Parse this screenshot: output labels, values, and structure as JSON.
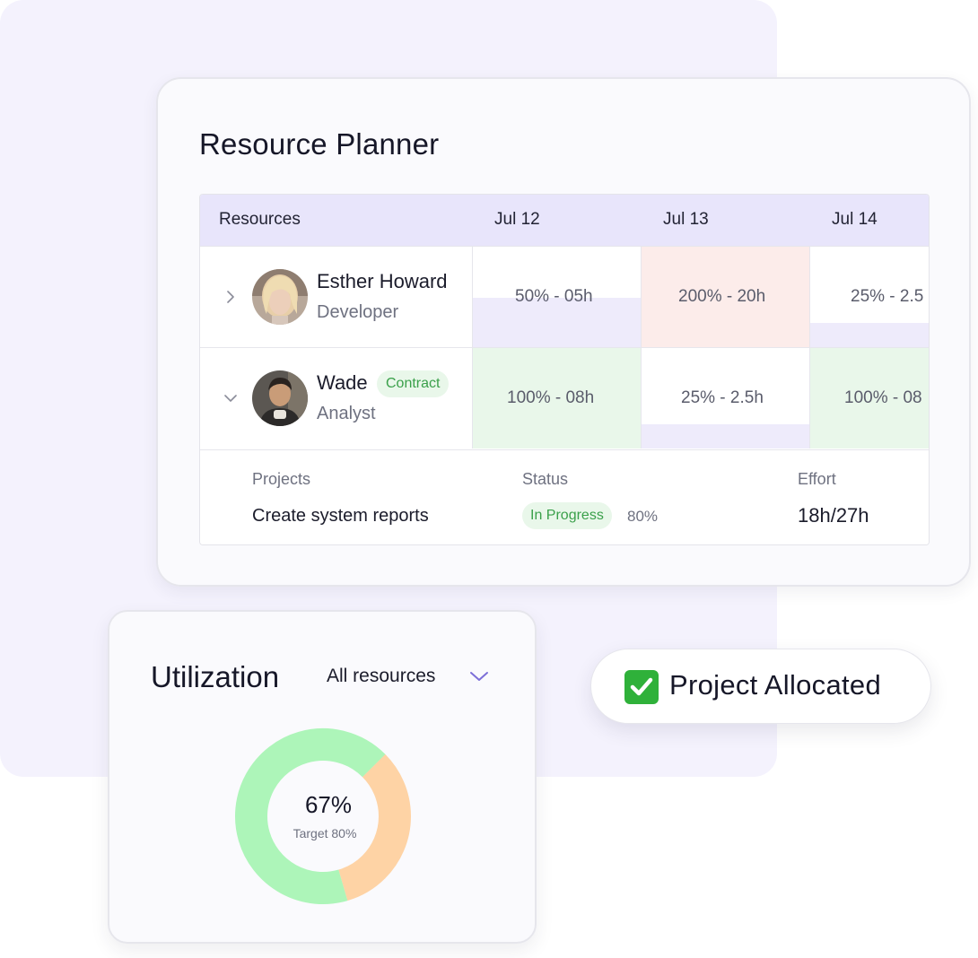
{
  "planner": {
    "title": "Resource Planner",
    "headers": {
      "resources": "Resources",
      "col1": "Jul 12",
      "col2": "Jul 13",
      "col3": "Jul 14"
    },
    "rows": [
      {
        "name": "Esther Howard",
        "role": "Developer",
        "tag": "",
        "expanded": false,
        "chevron_icon": "chevron-right-icon",
        "cells": [
          {
            "text": "50% - 05h",
            "allocation": 0.5,
            "fill_color": "#eeebfb",
            "bg_color": "#ffffff"
          },
          {
            "text": "200% - 20h",
            "allocation": 2.0,
            "fill_color": "#fcecea",
            "bg_color": "#fcecea"
          },
          {
            "text": "25% - 2.5",
            "allocation": 0.25,
            "fill_color": "#eeebfb",
            "bg_color": "#ffffff"
          }
        ]
      },
      {
        "name": "Wade",
        "role": "Analyst",
        "tag": "Contract",
        "expanded": true,
        "chevron_icon": "chevron-down-icon",
        "cells": [
          {
            "text": "100% - 08h",
            "allocation": 1.0,
            "fill_color": "#e9f7ea",
            "bg_color": "#e9f7ea"
          },
          {
            "text": "25% - 2.5h",
            "allocation": 0.25,
            "fill_color": "#eeebfb",
            "bg_color": "#ffffff"
          },
          {
            "text": "100% - 08",
            "allocation": 1.0,
            "fill_color": "#e9f7ea",
            "bg_color": "#e9f7ea"
          }
        ]
      }
    ],
    "detail": {
      "projects_label": "Projects",
      "status_label": "Status",
      "effort_label": "Effort",
      "project_name": "Create system reports",
      "status": "In Progress",
      "status_percent": "80%",
      "effort": "18h/27h"
    }
  },
  "utilization": {
    "title": "Utilization",
    "filter": "All resources",
    "value_text": "67%",
    "target_text": "Target 80%",
    "value_fraction": 0.67,
    "target_fraction": 0.8,
    "colors": {
      "value": "#adf5b9",
      "gap": "#fed3a5"
    }
  },
  "toast": {
    "text": "Project Allocated",
    "icon": "check-mark-icon"
  },
  "colors": {
    "header_bg": "#e8e5fb",
    "accent": "#7c6fd8",
    "success": "#3aa04a",
    "background": "#f4f2fd"
  }
}
